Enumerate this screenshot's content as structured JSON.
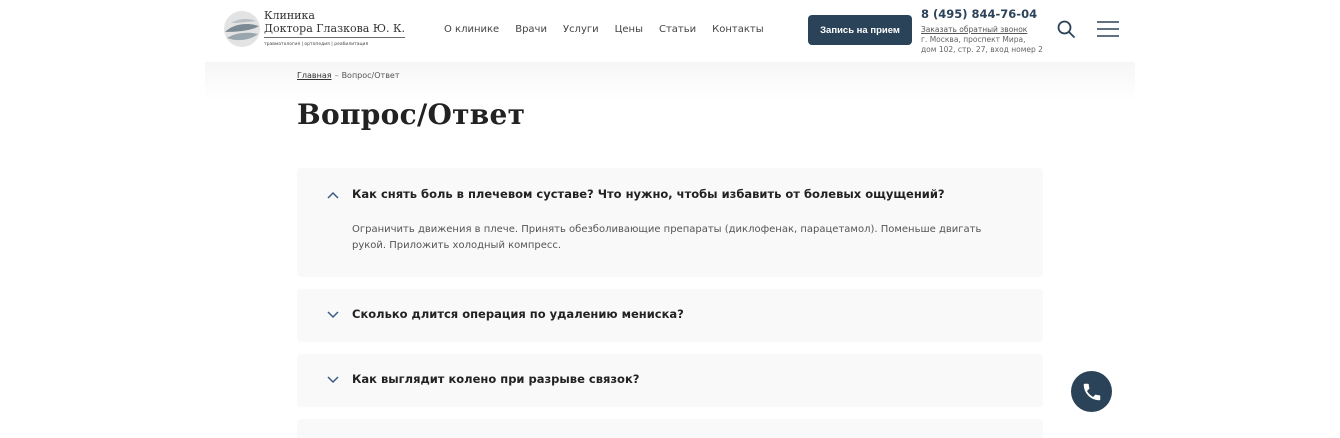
{
  "header": {
    "logo": {
      "line1": "Клиника",
      "line2": "Доктора Глазкова Ю. К.",
      "subtitle": "травматология | ортопедия | реабилитация"
    },
    "nav": [
      "О клинике",
      "Врачи",
      "Услуги",
      "Цены",
      "Статьи",
      "Контакты"
    ],
    "appointment_label": "Запись на прием",
    "phone": "8 (495) 844-76-04",
    "callback_label": "Заказать обратный звонок",
    "address_line1": "г. Москва, проспект Мира,",
    "address_line2": "дом 102, стр. 27, вход номер 2"
  },
  "breadcrumb": {
    "home": "Главная",
    "separator": "–",
    "current": "Вопрос/Ответ"
  },
  "page_title": "Вопрос/Ответ",
  "faq": [
    {
      "question": "Как снять боль в плечевом суставе? Что нужно, чтобы избавить от болевых ощущений?",
      "answer": "Ограничить движения в плече. Принять обезболивающие препараты (диклофенак, парацетамол). Поменьше двигать рукой. Приложить холодный компресс.",
      "expanded": true
    },
    {
      "question": "Сколько длится операция по удалению мениска?",
      "expanded": false
    },
    {
      "question": "Как выглядит колено при разрыве связок?",
      "expanded": false
    }
  ],
  "colors": {
    "brand": "#2b4358",
    "card_bg": "#f9f9f9",
    "chevron": "#3b5a8a"
  },
  "icons": {
    "search": "search-icon",
    "menu": "hamburger-menu-icon",
    "call": "phone-icon",
    "expanded": "chevron-up-icon",
    "collapsed": "chevron-down-icon"
  }
}
